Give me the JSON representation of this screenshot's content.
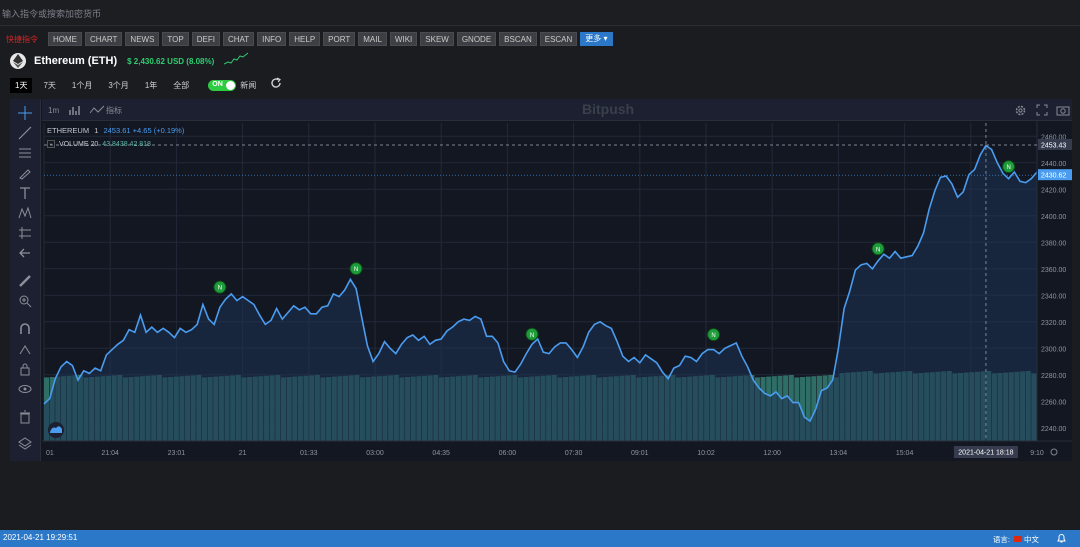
{
  "command_bar": {
    "placeholder": "输入指令或搜索加密货币"
  },
  "nav": {
    "prefix": "快捷指令",
    "items": [
      "HOME",
      "CHART",
      "NEWS",
      "TOP",
      "DEFI",
      "CHAT",
      "INFO",
      "HELP",
      "PORT",
      "MAIL",
      "WIKI",
      "SKEW",
      "GNODE",
      "BSCAN",
      "ESCAN"
    ],
    "more": "更多 ▾"
  },
  "coin": {
    "name": "Ethereum (ETH)",
    "price": "$ 2,430.62 USD (8.08%)"
  },
  "timeframes": [
    "1天",
    "7天",
    "1个月",
    "3个月",
    "1年",
    "全部"
  ],
  "toggle": {
    "label": "ON",
    "news": "新闻"
  },
  "chart_toolbar": {
    "interval": "1m",
    "indicators": "指标",
    "watermark": "Bitpush"
  },
  "legend": {
    "symbol": "ETHEREUM",
    "interval": "1",
    "values": "2453.61 +4.65 (+0.19%)",
    "volume_label": "VOLUME 20",
    "volume_values": "43.8438  42.818"
  },
  "colors": {
    "price_line": "#4a9cf0",
    "volume": "#2f6e66",
    "news_marker": "#1f9c3a",
    "status_bar": "#2a78c7",
    "price_up": "#2ecc71"
  },
  "chart_data": {
    "type": "line",
    "title": "",
    "xlabel": "",
    "ylabel": "",
    "ylim": [
      2230,
      2470
    ],
    "yticks": [
      2240,
      2260,
      2280,
      2300,
      2320,
      2340,
      2360,
      2380,
      2400,
      2420,
      2440,
      2460
    ],
    "xticks": [
      "01",
      "21:04",
      "23:01",
      "21",
      "01:33",
      "03:00",
      "04:35",
      "06:00",
      "07:30",
      "09:01",
      "10:02",
      "12:00",
      "13:04",
      "15:04",
      "16:04",
      "9:10"
    ],
    "crosshair": {
      "time": "2021-04-21   18:18",
      "price": "2453.43"
    },
    "last_price_label": "2430.62",
    "series": [
      {
        "values": [
          2258,
          2262,
          2277,
          2286,
          2290,
          2287,
          2276,
          2283,
          2281,
          2285,
          2283,
          2295,
          2299,
          2303,
          2306,
          2314,
          2312,
          2325,
          2312,
          2316,
          2312,
          2315,
          2312,
          2308,
          2315,
          2312,
          2314,
          2318,
          2333,
          2322,
          2318,
          2331,
          2337,
          2341,
          2336,
          2339,
          2336,
          2333,
          2325,
          2318,
          2321,
          2330,
          2322,
          2327,
          2332,
          2329,
          2331,
          2326,
          2326,
          2331,
          2332,
          2341,
          2339,
          2344,
          2352,
          2345,
          2323,
          2302,
          2290,
          2296,
          2305,
          2300,
          2296,
          2303,
          2308,
          2310,
          2306,
          2309,
          2303,
          2306,
          2307,
          2313,
          2316,
          2320,
          2322,
          2321,
          2324,
          2322,
          2309,
          2309,
          2304,
          2290,
          2283,
          2282,
          2288,
          2296,
          2303,
          2307,
          2297,
          2296,
          2301,
          2304,
          2304,
          2299,
          2293,
          2301,
          2312,
          2318,
          2320,
          2317,
          2315,
          2305,
          2294,
          2290,
          2293,
          2289,
          2295,
          2292,
          2289,
          2282,
          2277,
          2285,
          2287,
          2294,
          2293,
          2290,
          2296,
          2299,
          2299,
          2296,
          2300,
          2302,
          2304,
          2294,
          2286,
          2276,
          2270,
          2266,
          2264,
          2267,
          2262,
          2264,
          2259,
          2259,
          2248,
          2245,
          2254,
          2268,
          2270,
          2276,
          2300,
          2330,
          2343,
          2359,
          2363,
          2364,
          2360,
          2366,
          2371,
          2368,
          2373,
          2368,
          2369,
          2370,
          2377,
          2387,
          2405,
          2419,
          2429,
          2430,
          2424,
          2414,
          2418,
          2431,
          2435,
          2446,
          2453,
          2450,
          2440,
          2432,
          2428,
          2433,
          2426,
          2425,
          2428,
          2433
        ]
      }
    ],
    "volume_level": 0.8,
    "news_markers": 6
  },
  "status": {
    "datetime": "2021-04-21 19:29:51",
    "lang_label": "语言:",
    "lang": "中文"
  }
}
